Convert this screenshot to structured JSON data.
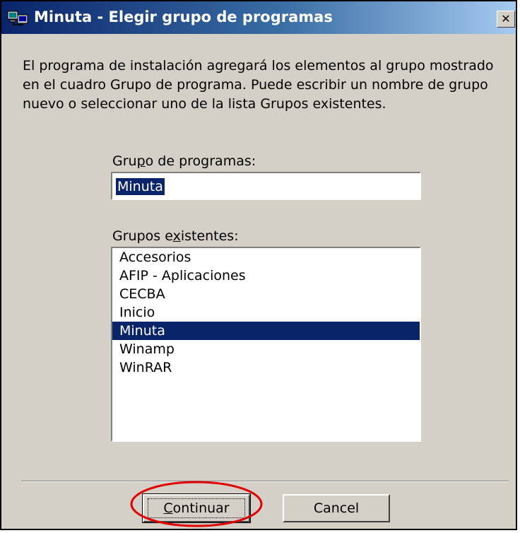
{
  "window": {
    "title": "Minuta - Elegir grupo de programas",
    "close_glyph": "✕",
    "icon": "installer-icon"
  },
  "description": "El programa de instalación agregará los elementos al grupo mostrado en el cuadro Grupo de programa. Puede escribir un nombre de grupo nuevo o seleccionar uno de la lista Grupos existentes.",
  "program_group": {
    "label_before": "Gru",
    "label_mnemonic": "p",
    "label_after": "o de programas:",
    "value": "Minuta"
  },
  "existing_groups": {
    "label_before": "Grupos e",
    "label_mnemonic": "x",
    "label_after": "istentes:",
    "items": [
      "Accesorios",
      "AFIP - Aplicaciones",
      "CECBA",
      "Inicio",
      "Minuta",
      "Winamp",
      "WinRAR"
    ],
    "selected_index": 4
  },
  "buttons": {
    "continue_mnemonic": "C",
    "continue_rest": "ontinuar",
    "cancel": "Cancel"
  },
  "colors": {
    "selection": "#0a246a",
    "dialog_face": "#d4d0c8",
    "annotation": "#e00000"
  }
}
